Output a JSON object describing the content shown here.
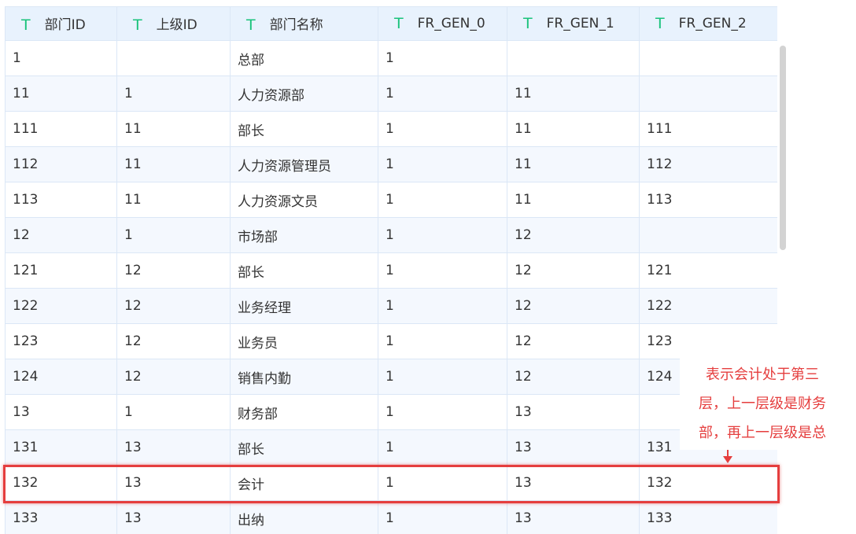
{
  "columns": [
    {
      "type_icon": "T",
      "label": "部门ID"
    },
    {
      "type_icon": "T",
      "label": "上级ID"
    },
    {
      "type_icon": "T",
      "label": "部门名称"
    },
    {
      "type_icon": "T",
      "label": "FR_GEN_0"
    },
    {
      "type_icon": "T",
      "label": "FR_GEN_1"
    },
    {
      "type_icon": "T",
      "label": "FR_GEN_2"
    }
  ],
  "rows": [
    [
      "1",
      "",
      "总部",
      "1",
      "",
      ""
    ],
    [
      "11",
      "1",
      "人力资源部",
      "1",
      "11",
      ""
    ],
    [
      "111",
      "11",
      "部长",
      "1",
      "11",
      "111"
    ],
    [
      "112",
      "11",
      "人力资源管理员",
      "1",
      "11",
      "112"
    ],
    [
      "113",
      "11",
      "人力资源文员",
      "1",
      "11",
      "113"
    ],
    [
      "12",
      "1",
      "市场部",
      "1",
      "12",
      ""
    ],
    [
      "121",
      "12",
      "部长",
      "1",
      "12",
      "121"
    ],
    [
      "122",
      "12",
      "业务经理",
      "1",
      "12",
      "122"
    ],
    [
      "123",
      "12",
      "业务员",
      "1",
      "12",
      "123"
    ],
    [
      "124",
      "12",
      "销售内勤",
      "1",
      "12",
      "124"
    ],
    [
      "13",
      "1",
      "财务部",
      "1",
      "13",
      ""
    ],
    [
      "131",
      "13",
      "部长",
      "1",
      "13",
      "131"
    ],
    [
      "132",
      "13",
      "会计",
      "1",
      "13",
      "132"
    ],
    [
      "133",
      "13",
      "出纳",
      "1",
      "13",
      "133"
    ]
  ],
  "annotation": {
    "lines": [
      "表示会计处于第三",
      "层，上一层级是财务",
      "部，再上一层级是总"
    ],
    "highlighted_row_dept_id": "132",
    "color": "#e53e3e"
  },
  "colors": {
    "header_bg": "#e8f2fd",
    "type_icon": "#18c27a",
    "border": "#dbe7f6"
  }
}
